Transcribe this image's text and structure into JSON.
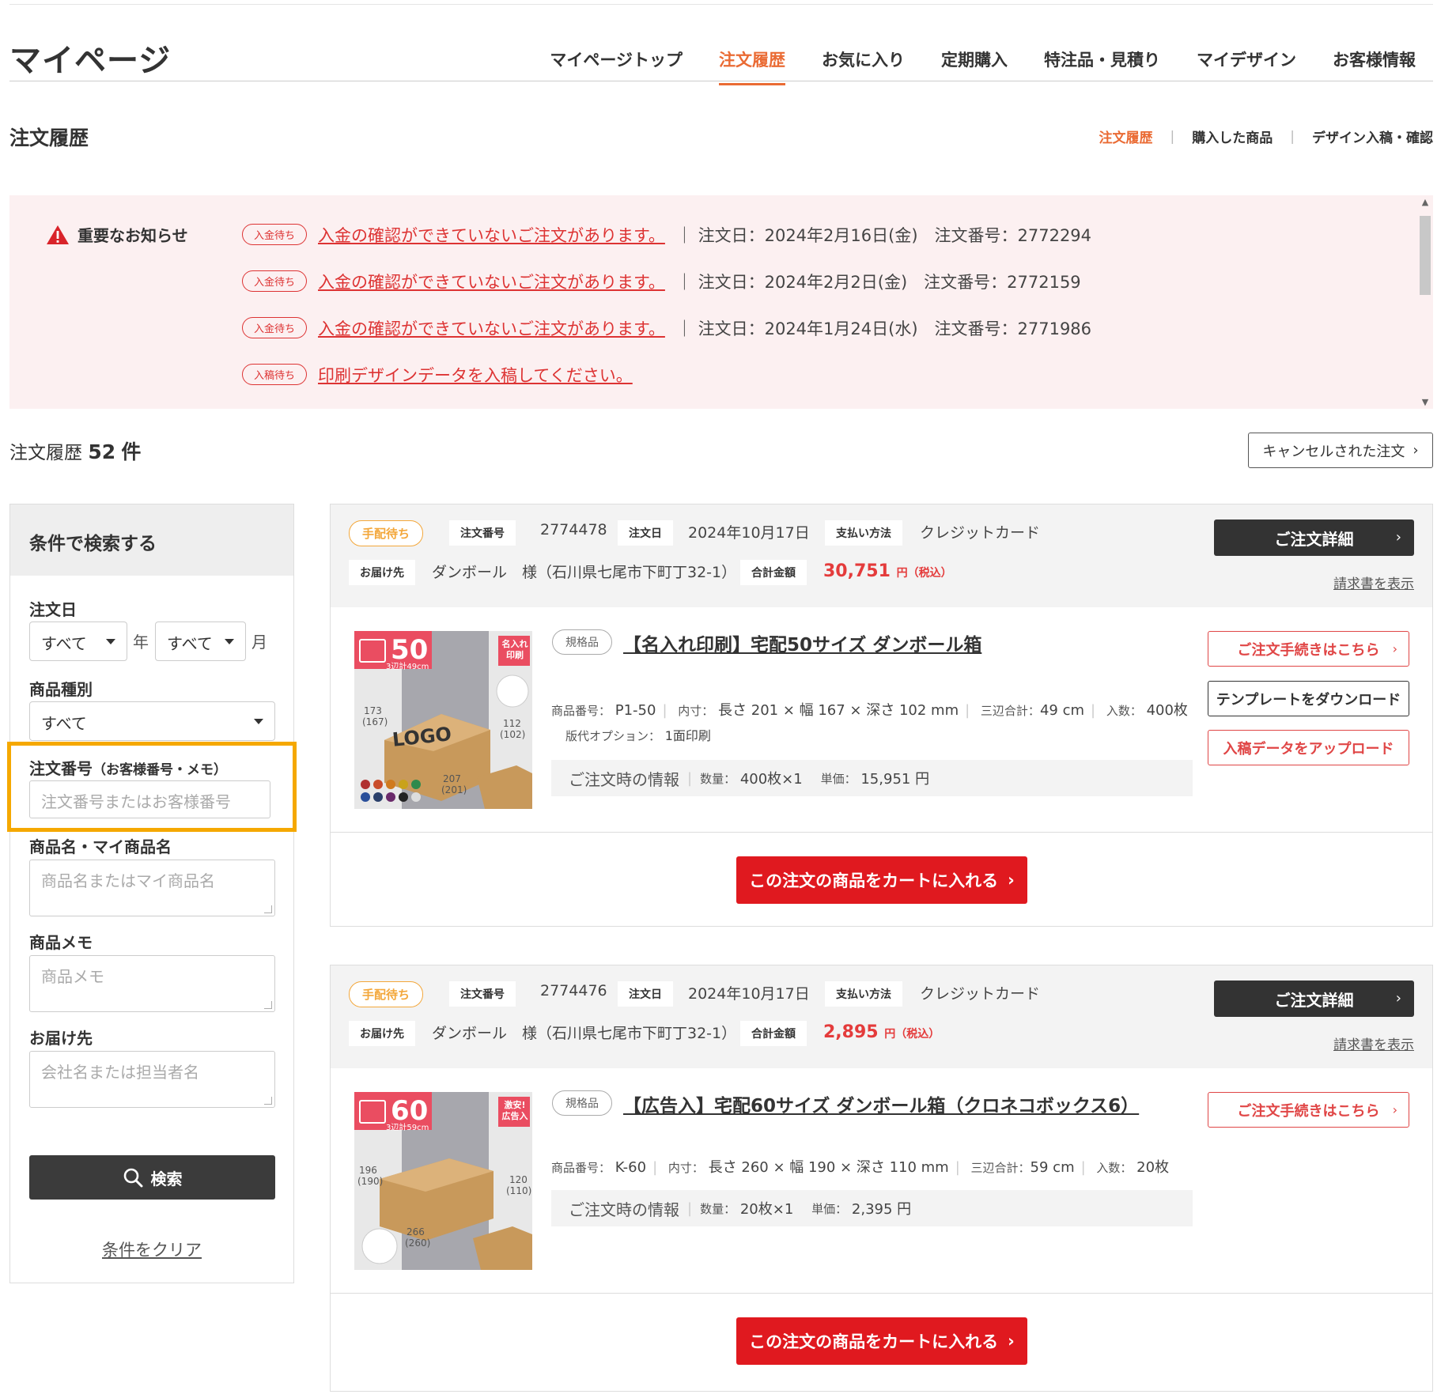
{
  "header": {
    "title": "マイページ",
    "nav": [
      "マイページトップ",
      "注文履歴",
      "お気に入り",
      "定期購入",
      "特注品・見積り",
      "マイデザイン",
      "お客様情報"
    ],
    "active_nav": "注文履歴"
  },
  "section": {
    "title": "注文履歴",
    "subnav": [
      "注文履歴",
      "購入した商品",
      "デザイン入稿・確認"
    ]
  },
  "notice": {
    "heading": "重要なお知らせ",
    "rows": [
      {
        "badge": "入金待ち",
        "link": "入金の確認ができていないご注文があります。",
        "info": "｜ 注文日：2024年2月16日(金)　注文番号：2772294"
      },
      {
        "badge": "入金待ち",
        "link": "入金の確認ができていないご注文があります。",
        "info": "｜ 注文日：2024年2月2日(金)　注文番号：2772159"
      },
      {
        "badge": "入金待ち",
        "link": "入金の確認ができていないご注文があります。",
        "info": "｜ 注文日：2024年1月24日(水)　注文番号：2771986"
      },
      {
        "badge": "入稿待ち",
        "link": "印刷デザインデータを入稿してください。",
        "info": ""
      }
    ]
  },
  "history": {
    "label": "注文履歴",
    "count": "52",
    "unit": "件",
    "cancel_button": "キャンセルされた注文"
  },
  "sidebar": {
    "title": "条件で検索する",
    "order_date_label": "注文日",
    "year_value": "すべて",
    "year_unit": "年",
    "month_value": "すべて",
    "month_unit": "月",
    "type_label": "商品種別",
    "type_value": "すべて",
    "order_no_label": "注文番号",
    "order_no_label_sub": "（お客様番号・メモ）",
    "order_no_placeholder": "注文番号またはお客様番号",
    "product_label": "商品名・マイ商品名",
    "product_placeholder": "商品名またはマイ商品名",
    "memo_label": "商品メモ",
    "memo_placeholder": "商品メモ",
    "dest_label": "お届け先",
    "dest_placeholder": "会社名または担当者名",
    "search_button": "検索",
    "clear_link": "条件をクリア"
  },
  "labels": {
    "order_no": "注文番号",
    "order_date": "注文日",
    "payment": "支払い方法",
    "dest": "お届け先",
    "total": "合計金額",
    "yen": "円",
    "tax": "（税込）",
    "detail_button": "ご注文詳細",
    "invoice_link": "請求書を表示",
    "product_tag": "規格品",
    "code_key": "商品番号：",
    "inner_key": "内寸：",
    "sum_key": "三辺合計：",
    "qty_key": "入数：",
    "plate_key": "版代オプション：",
    "info_label": "ご注文時の情報",
    "amount_key": "数量：",
    "unit_price_key": "単価：",
    "cart_button": "この注文の商品をカートに入れる",
    "procedure_button": "ご注文手続きはこちら",
    "template_button": "テンプレートをダウンロード",
    "upload_button": "入稿データをアップロード"
  },
  "orders": [
    {
      "status": "手配待ち",
      "order_no": "2774478",
      "date": "2024年10月17日",
      "payment": "クレジットカード",
      "dest": "ダンボール　様（石川県七尾市下町丁32-1）",
      "total": "30,751",
      "product_name": "【名入れ印刷】宅配50サイズ ダンボール箱",
      "code": "P1-50",
      "inner": "長さ 201 × 幅 167 × 深さ 102 mm",
      "sum": "49 cm",
      "qty": "400枚",
      "plate": "1面印刷",
      "amount": "400枚×1",
      "unit_price": "15,951 円",
      "img_size": "50",
      "img_sub": "3辺計49cm",
      "img_badge": "名入れ印刷",
      "img_logo": "LOGO",
      "img_dims": [
        "173",
        "(167)",
        "112",
        "(102)",
        "207",
        "(201)"
      ]
    },
    {
      "status": "手配待ち",
      "order_no": "2774476",
      "date": "2024年10月17日",
      "payment": "クレジットカード",
      "dest": "ダンボール　様（石川県七尾市下町丁32-1）",
      "total": "2,895",
      "product_name": "【広告入】宅配60サイズ ダンボール箱（クロネコボックス6）",
      "code": "K-60",
      "inner": "長さ 260 × 幅 190 × 深さ 110 mm",
      "sum": "59 cm",
      "qty": "20枚",
      "amount": "20枚×1",
      "unit_price": "2,395 円",
      "img_size": "60",
      "img_sub": "3辺計59cm",
      "img_badge": "激安!広告入",
      "img_dims": [
        "196",
        "(190)",
        "120",
        "(110)",
        "266",
        "(260)"
      ]
    }
  ],
  "colors": {
    "accent": "#ea6b34",
    "danger": "#e0191f",
    "notice_bg": "#fcf0f1",
    "status": "#f3a73b",
    "highlight": "#f5a800"
  }
}
